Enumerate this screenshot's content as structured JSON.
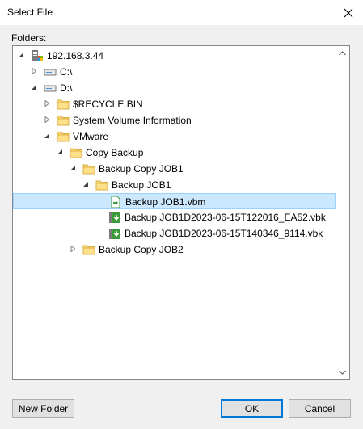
{
  "window": {
    "title": "Select File"
  },
  "folders_label": "Folders:",
  "tree": [
    {
      "label": "192.168.3.44",
      "icon": "server-icon",
      "expanded": true,
      "level": 0
    },
    {
      "label": "C:\\",
      "icon": "drive-icon",
      "expanded": false,
      "level": 1
    },
    {
      "label": "D:\\",
      "icon": "drive-icon",
      "expanded": true,
      "level": 1
    },
    {
      "label": "$RECYCLE.BIN",
      "icon": "folder-icon",
      "expanded": false,
      "level": 2
    },
    {
      "label": "System Volume Information",
      "icon": "folder-icon",
      "expanded": false,
      "level": 2
    },
    {
      "label": "VMware",
      "icon": "folder-icon",
      "expanded": true,
      "level": 2
    },
    {
      "label": "Copy Backup",
      "icon": "folder-icon",
      "expanded": true,
      "level": 3
    },
    {
      "label": "Backup Copy JOB1",
      "icon": "folder-icon",
      "expanded": true,
      "level": 4
    },
    {
      "label": "Backup JOB1",
      "icon": "folder-icon",
      "expanded": true,
      "level": 5
    },
    {
      "label": "Backup JOB1.vbm",
      "icon": "vbm-file-icon",
      "level": 6,
      "selected": true
    },
    {
      "label": "Backup JOB1D2023-06-15T122016_EA52.vbk",
      "icon": "vbk-file-icon",
      "level": 6
    },
    {
      "label": "Backup JOB1D2023-06-15T140346_9114.vbk",
      "icon": "vbk-file-icon",
      "level": 6
    },
    {
      "label": "Backup Copy JOB2",
      "icon": "folder-icon",
      "expanded": false,
      "level": 4
    }
  ],
  "buttons": {
    "new_folder": "New Folder",
    "ok": "OK",
    "cancel": "Cancel"
  },
  "colors": {
    "selection": "#cce8ff",
    "folder": "#f8d775",
    "accent": "#0078d7"
  }
}
